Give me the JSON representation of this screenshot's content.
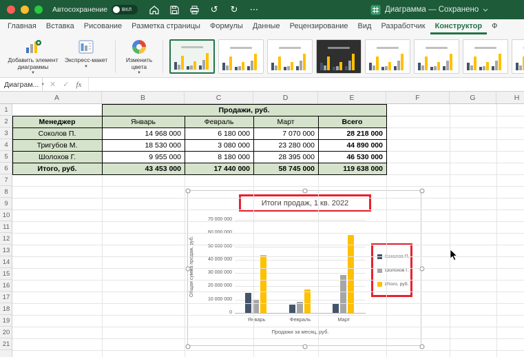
{
  "titlebar": {
    "autosave_label": "Автосохранение",
    "autosave_state": "ВКЛ",
    "doc_title": "Диаграмма — Сохранено"
  },
  "tabs": [
    {
      "label": "Главная",
      "active": false
    },
    {
      "label": "Вставка",
      "active": false
    },
    {
      "label": "Рисование",
      "active": false
    },
    {
      "label": "Разметка страницы",
      "active": false
    },
    {
      "label": "Формулы",
      "active": false
    },
    {
      "label": "Данные",
      "active": false
    },
    {
      "label": "Рецензирование",
      "active": false
    },
    {
      "label": "Вид",
      "active": false
    },
    {
      "label": "Разработчик",
      "active": false
    },
    {
      "label": "Конструктор",
      "active": true
    },
    {
      "label": "Ф",
      "active": false
    }
  ],
  "ribbon": {
    "add_element_label": "Добавить элемент диаграммы",
    "quick_layout_label": "Экспресс-макет",
    "change_colors_label": "Изменить цвета",
    "gallery": [
      {
        "selected": true,
        "dark": false
      },
      {
        "selected": false,
        "dark": false
      },
      {
        "selected": false,
        "dark": false
      },
      {
        "selected": false,
        "dark": true
      },
      {
        "selected": false,
        "dark": false
      },
      {
        "selected": false,
        "dark": false
      },
      {
        "selected": false,
        "dark": false
      },
      {
        "selected": false,
        "dark": false
      }
    ]
  },
  "formula_bar": {
    "name_box": "Диаграм...",
    "cancel_glyph": "✕",
    "enter_glyph": "✓",
    "fx_label": "fx"
  },
  "sheet": {
    "col_headers": [
      "A",
      "B",
      "C",
      "D",
      "E",
      "F",
      "G",
      "H"
    ],
    "visible_rows": 21,
    "table": {
      "title": "Продажи, руб.",
      "header_row": [
        "Менеджер",
        "Январь",
        "Февраль",
        "Март",
        "Всего"
      ],
      "data_rows": [
        [
          "Соколов П.",
          "14 968 000",
          "6 180 000",
          "7 070 000",
          "28 218 000"
        ],
        [
          "Тригубов М.",
          "18 530 000",
          "3 080 000",
          "23 280 000",
          "44 890 000"
        ],
        [
          "Шолохов Г.",
          "9 955 000",
          "8 180 000",
          "28 395 000",
          "46 530 000"
        ]
      ],
      "total_row": [
        "Итого, руб.",
        "43 453 000",
        "17 440 000",
        "58 745 000",
        "119 638 000"
      ]
    }
  },
  "chart_data": {
    "type": "bar",
    "title": "Итоги продаж, 1 кв. 2022",
    "categories": [
      "Январь",
      "Февраль",
      "Март"
    ],
    "series": [
      {
        "name": "Соколов П.",
        "color": "#44546A",
        "values": [
          14968000,
          6180000,
          7070000
        ]
      },
      {
        "name": "Шолохов Г.",
        "color": "#A6A6A6",
        "values": [
          9955000,
          8180000,
          28395000
        ]
      },
      {
        "name": "Итого, руб.",
        "color": "#FFC000",
        "values": [
          43453000,
          17440000,
          58745000
        ]
      }
    ],
    "xlabel": "Продажи за месяц, руб.",
    "ylabel": "Общая сумма продаж, руб.",
    "ylim": [
      0,
      70000000
    ],
    "ytick_labels": [
      "0",
      "10 000 000",
      "20 000 000",
      "30 000 000",
      "40 000 000",
      "50 000 000",
      "60 000 000",
      "70 000 000"
    ],
    "legend_position": "right",
    "grid": true
  },
  "colors": {
    "highlight": "#E8212E",
    "header_fill": "#D6E3CC",
    "accent_green": "#217346",
    "titlebar_green": "#1D5B39"
  }
}
